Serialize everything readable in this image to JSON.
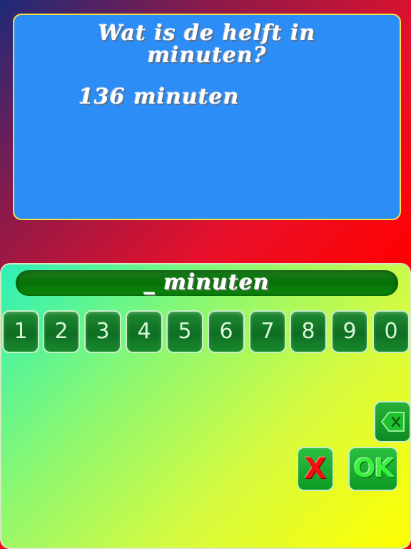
{
  "question": {
    "line1": "Wat is de helft in",
    "line2": "minuten?",
    "value": "136 minuten"
  },
  "answer": {
    "display": "_ minuten"
  },
  "keypad": {
    "keys": [
      "1",
      "2",
      "3",
      "4",
      "5",
      "6",
      "7",
      "8",
      "9",
      "0"
    ]
  },
  "controls": {
    "backspace_icon": "backspace-icon",
    "clear_label": "X",
    "ok_label": "OK"
  },
  "colors": {
    "question_panel": "#2b8df5",
    "answer_bar": "#067006",
    "clear": "#f01010",
    "ok": "#3cf040"
  }
}
